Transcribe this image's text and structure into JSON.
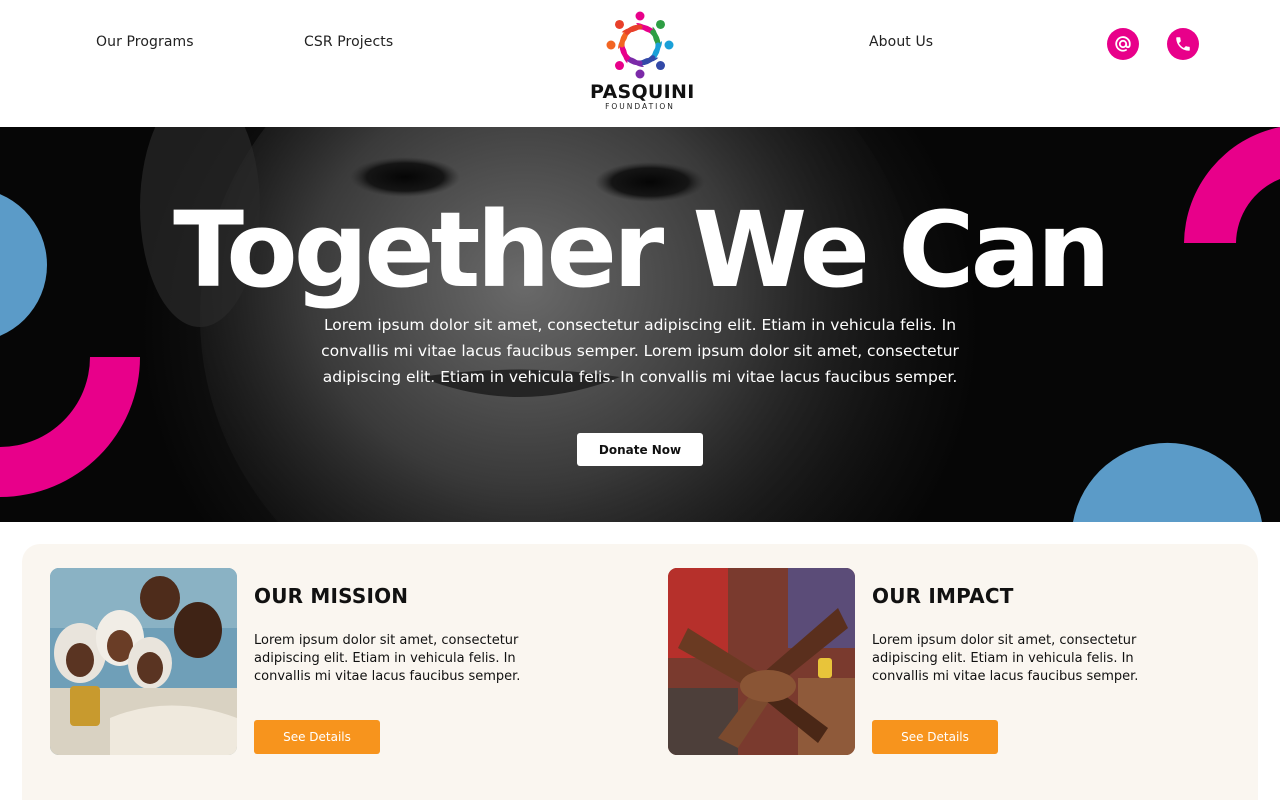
{
  "header": {
    "nav_left": [
      "Our Programs",
      "CSR Projects"
    ],
    "nav_right": [
      "About Us"
    ],
    "logo_name": "PASQUINI",
    "logo_sub": "FOUNDATION",
    "icons": [
      "at-icon",
      "phone-icon"
    ],
    "icon_color": "#e8008a"
  },
  "hero": {
    "title": "Together We Can",
    "text": "Lorem ipsum dolor sit amet, consectetur adipiscing elit. Etiam in vehicula felis. In convallis mi vitae lacus faucibus semper. Lorem ipsum dolor sit amet, consectetur adipiscing elit. Etiam in vehicula felis. In convallis mi vitae lacus faucibus semper.",
    "button": "Donate Now"
  },
  "cards": [
    {
      "title": "OUR MISSION",
      "text": "Lorem ipsum dolor sit amet, consectetur adipiscing elit. Etiam in vehicula felis. In convallis mi vitae lacus faucibus semper.",
      "button": "See Details"
    },
    {
      "title": "OUR IMPACT",
      "text": "Lorem ipsum dolor sit amet, consectetur adipiscing elit. Etiam in vehicula felis. In convallis mi vitae lacus faucibus semper.",
      "button": "See Details"
    }
  ],
  "colors": {
    "accent_pink": "#e8008a",
    "accent_blue": "#5b9bc8",
    "accent_orange": "#f7941d",
    "section_bg": "#faf6f0"
  }
}
